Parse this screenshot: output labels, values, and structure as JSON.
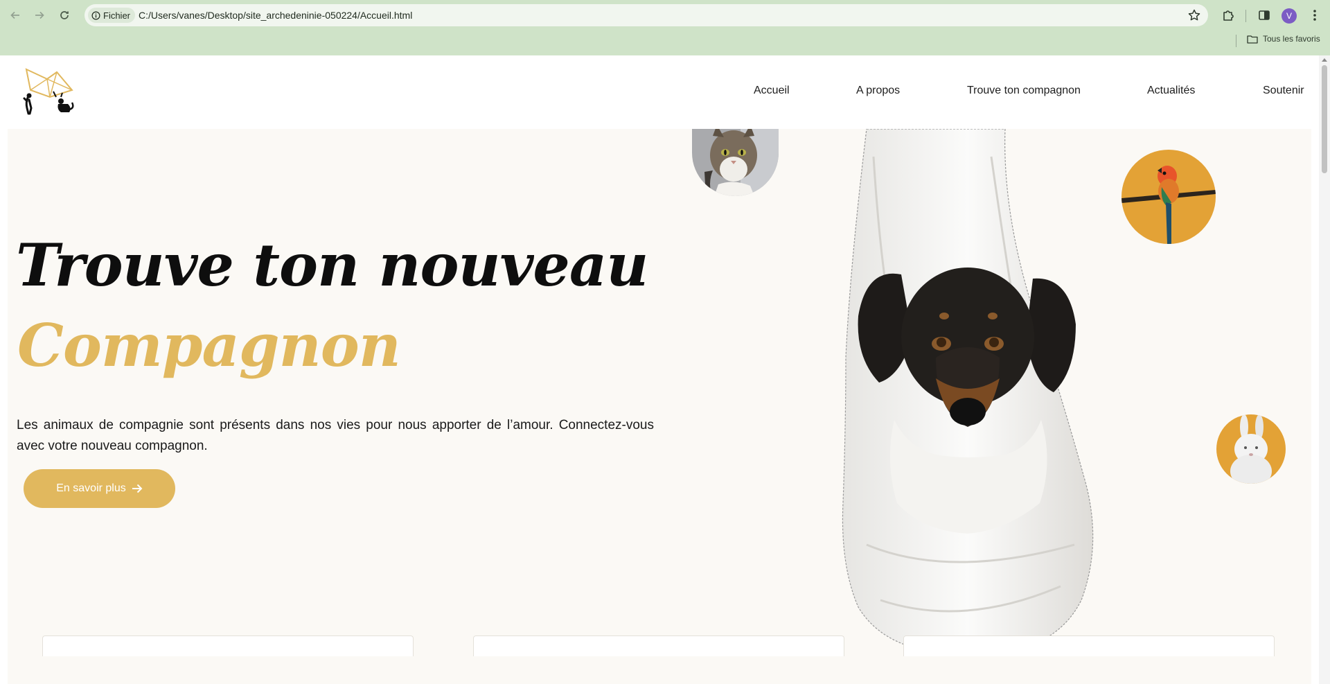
{
  "browser": {
    "site_chip": "Fichier",
    "url": "C:/Users/vanes/Desktop/site_archedeninie-050224/Accueil.html",
    "profile_initial": "V",
    "bookmarks_all": "Tous les favoris"
  },
  "nav": {
    "items": [
      "Accueil",
      "A propos",
      "Trouve ton compagnon",
      "Actualités",
      "Soutenir"
    ]
  },
  "hero": {
    "title": "Trouve ton nouveau",
    "subtitle": "Compagnon",
    "description": "Les animaux de compagnie sont présents dans nos vies pour nous apporter de l’amour. Connectez-vous avec votre nouveau compagnon.",
    "cta_label": "En savoir plus"
  },
  "colors": {
    "accent": "#e1b85e",
    "chrome": "#cfe3c8",
    "hero_bg": "#fbf9f5",
    "circle_orange": "#e3a236"
  }
}
